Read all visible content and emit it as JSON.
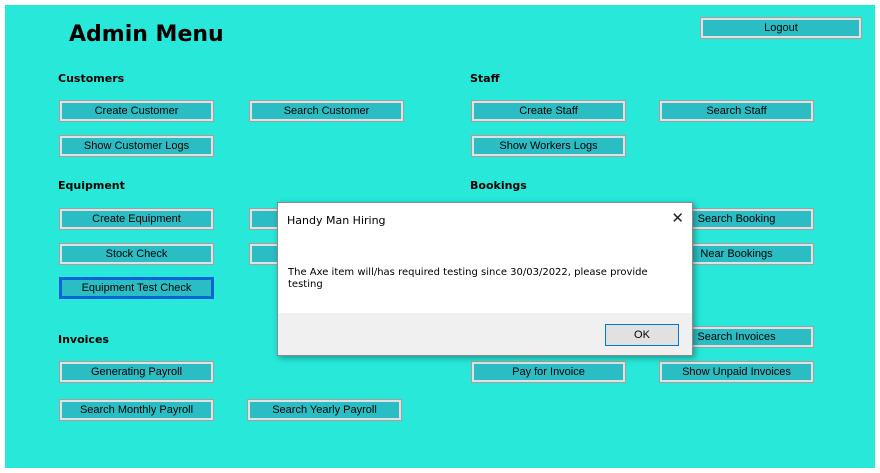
{
  "header": {
    "title": "Admin Menu",
    "logout_label": "Logout"
  },
  "customers": {
    "heading": "Customers",
    "create": "Create Customer",
    "search": "Search Customer",
    "logs": "Show Customer Logs"
  },
  "staff": {
    "heading": "Staff",
    "create": "Create Staff",
    "search": "Search Staff",
    "logs": "Show Workers Logs"
  },
  "equipment": {
    "heading": "Equipment",
    "create": "Create Equipment",
    "stock": "Stock Check",
    "test_check": "Equipment Test Check"
  },
  "bookings": {
    "heading": "Bookings",
    "search": "Search Booking",
    "near": "Near Bookings"
  },
  "invoices": {
    "heading": "Invoices",
    "generating_payroll": "Generating Payroll",
    "search_monthly": "Search Monthly Payroll",
    "search_yearly": "Search Yearly Payroll",
    "search_invoices": "Search Invoices",
    "pay": "Pay for Invoice",
    "unpaid": "Show Unpaid Invoices"
  },
  "dialog": {
    "title": "Handy Man Hiring",
    "close_glyph": "✕",
    "message": "The Axe item will/has required testing since 30/03/2022, please provide testing",
    "ok_label": "OK"
  },
  "colors": {
    "background": "#27e8d9",
    "button": "#2abdc4",
    "dialog_footer": "#f0f0f0",
    "focus": "#0a64d6"
  }
}
